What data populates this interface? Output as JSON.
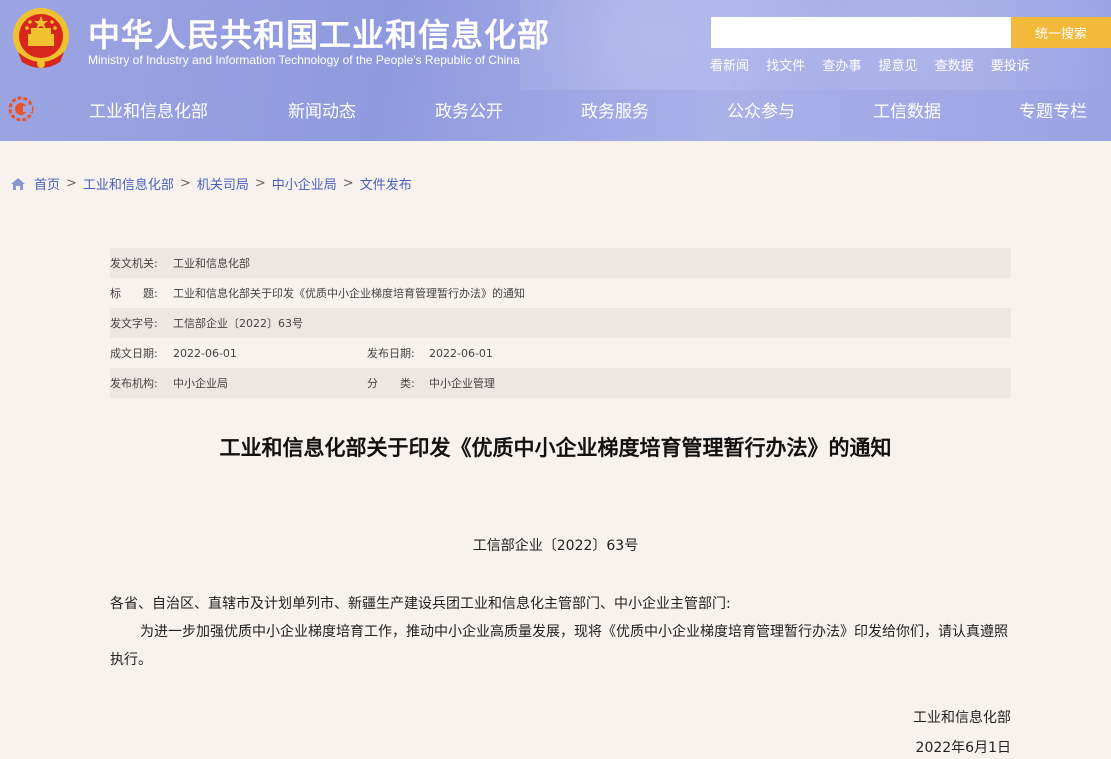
{
  "header": {
    "title_cn": "中华人民共和国工业和信息化部",
    "title_en": "Ministry of Industry and Information Technology of the People's Republic of China",
    "search_value": "",
    "search_button": "统一搜索",
    "quick_links": [
      "看新闻",
      "找文件",
      "查办事",
      "提意见",
      "查数据",
      "要投诉"
    ],
    "bg_color": "#9ca5e2",
    "search_btn_color": "#f3b93a"
  },
  "nav": {
    "items": [
      "工业和信息化部",
      "新闻动态",
      "政务公开",
      "政务服务",
      "公众参与",
      "工信数据",
      "专题专栏"
    ]
  },
  "breadcrumb": {
    "items": [
      "首页",
      "工业和信息化部",
      "机关司局",
      "中小企业局",
      "文件发布"
    ],
    "separator": ">"
  },
  "meta": {
    "issuer_label": "发文机关:",
    "issuer": "工业和信息化部",
    "title_label": "标　　题:",
    "title": "工业和信息化部关于印发《优质中小企业梯度培育管理暂行办法》的通知",
    "docno_label": "发文字号:",
    "docno": "工信部企业〔2022〕63号",
    "created_label": "成文日期:",
    "created": "2022-06-01",
    "published_label": "发布日期:",
    "published": "2022-06-01",
    "org_label": "发布机构:",
    "org": "中小企业局",
    "category_label": "分　　类:",
    "category": "中小企业管理"
  },
  "article": {
    "title": "工业和信息化部关于印发《优质中小企业梯度培育管理暂行办法》的通知",
    "doc_no": "工信部企业〔2022〕63号",
    "salutation": "各省、自治区、直辖市及计划单列市、新疆生产建设兵团工业和信息化主管部门、中小企业主管部门:",
    "body": "为进一步加强优质中小企业梯度培育工作，推动中小企业高质量发展，现将《优质中小企业梯度培育管理暂行办法》印发给你们，请认真遵照执行。",
    "sign_org": "工业和信息化部",
    "sign_date": "2022年6月1日"
  }
}
